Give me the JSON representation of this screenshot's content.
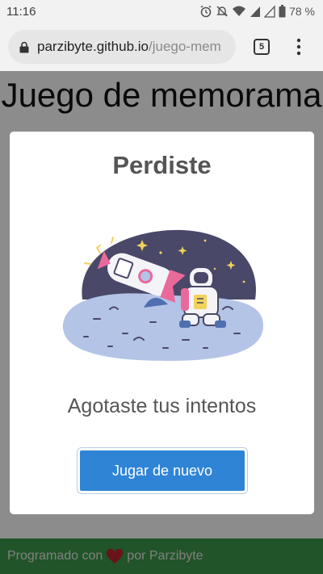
{
  "status_bar": {
    "time": "11:16",
    "battery_text": "78 %",
    "icons": [
      "alarm-icon",
      "notifications-off-icon",
      "wifi-icon",
      "signal-icon",
      "signal-empty-icon",
      "battery-icon"
    ]
  },
  "browser": {
    "url_host": "parzibyte.github.io",
    "url_path": "/juego-mem",
    "tab_count": "5",
    "icons": [
      "lock-icon",
      "tabs-icon",
      "menu-dots-icon"
    ]
  },
  "page": {
    "title": "Juego de memorama"
  },
  "modal": {
    "title": "Perdiste",
    "illustration": "astronaut-crashed-rocket-illustration",
    "message": "Agotaste tus intentos",
    "button_label": "Jugar de nuevo",
    "button_color": "#2f84d6"
  },
  "footer": {
    "text_before": "Programado con",
    "heart_icon": "heart-icon",
    "heart_color": "#c0262d",
    "text_after": "por Parzibyte",
    "color": "#3c9a4a"
  }
}
